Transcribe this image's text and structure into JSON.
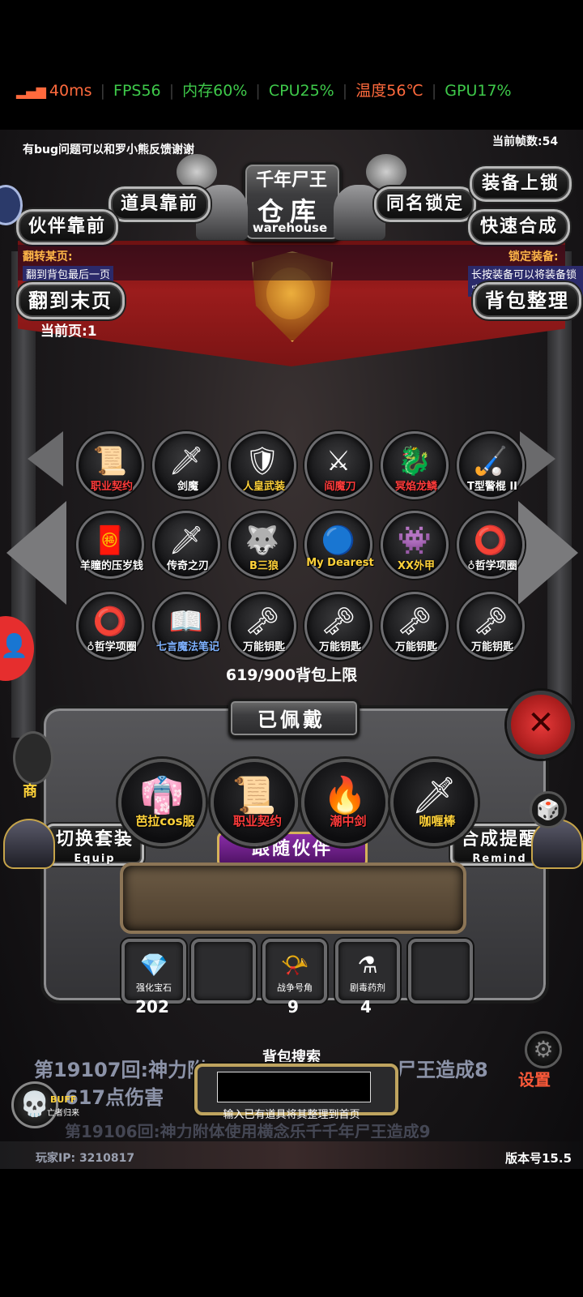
{
  "status": {
    "ping": "40ms",
    "fps": "FPS56",
    "memory": "内存60%",
    "cpu": "CPU25%",
    "temp": "温度56℃",
    "gpu": "GPU17%",
    "colors": {
      "ping": "#ff6a3d",
      "fps": "#3ec94a",
      "memory": "#3ec94a",
      "cpu": "#3ec94a",
      "temp": "#ff6a3d",
      "gpu": "#3ec94a"
    }
  },
  "header": {
    "frame_count": "当前帧数:54",
    "feedback": "有bug问题可以和罗小熊反馈谢谢",
    "boss_name": "千年尸王",
    "title_cn": "仓库",
    "title_en": "warehouse"
  },
  "buttons": {
    "items_first": "道具靠前",
    "companions_first": "伙伴靠前",
    "same_name_lock": "同名锁定",
    "equip_lock": "装备上锁",
    "quick_merge": "快速合成",
    "go_last_page": "翻到末页",
    "bag_sort": "背包整理",
    "switch_set": "切换套装",
    "switch_set_en": "Equip",
    "merge_remind": "合成提醒",
    "merge_remind_en": "Remind",
    "follow_companion": "跟随伙伴",
    "settings": "设置"
  },
  "hints": {
    "flip_page_title": "翻转某页:",
    "flip_page_desc": "翻到背包最后一页",
    "lock_equip_title": "锁定装备:",
    "lock_equip_desc": "长按装备可以将装备锁定",
    "current_page": "当前页:1"
  },
  "inventory": {
    "capacity": "619/900背包上限",
    "items": [
      {
        "label": "职业契约",
        "icon": "📜",
        "color": "#ff3b3b"
      },
      {
        "label": "剑魔",
        "icon": "🗡",
        "color": "#ffffff"
      },
      {
        "label": "人皇武装",
        "icon": "🛡",
        "color": "#ffd23a"
      },
      {
        "label": "阎魔刀",
        "icon": "⚔",
        "color": "#ff3b3b"
      },
      {
        "label": "冥焰龙鳞",
        "icon": "🐉",
        "color": "#ff3b3b"
      },
      {
        "label": "T型警棍 II",
        "icon": "🏑",
        "color": "#ffffff"
      },
      {
        "label": "羊瞳的压岁钱",
        "icon": "🧧",
        "color": "#ffffff"
      },
      {
        "label": "传奇之刃",
        "icon": "🗡",
        "color": "#ffffff"
      },
      {
        "label": "B三狼",
        "icon": "🐺",
        "color": "#ffd23a"
      },
      {
        "label": "My Dearest",
        "icon": "🔵",
        "color": "#ffd23a"
      },
      {
        "label": "XX外甲",
        "icon": "👾",
        "color": "#ffd23a"
      },
      {
        "label": "♁哲学项圈",
        "icon": "⭕",
        "color": "#ffffff"
      },
      {
        "label": "♁哲学项圈",
        "icon": "⭕",
        "color": "#ffffff"
      },
      {
        "label": "七言魔法笔记",
        "icon": "📖",
        "color": "#7fb2ff"
      },
      {
        "label": "万能钥匙",
        "icon": "🗝",
        "color": "#ffffff"
      },
      {
        "label": "万能钥匙",
        "icon": "🗝",
        "color": "#ffffff"
      },
      {
        "label": "万能钥匙",
        "icon": "🗝",
        "color": "#ffffff"
      },
      {
        "label": "万能钥匙",
        "icon": "🗝",
        "color": "#ffffff"
      }
    ]
  },
  "equipped": {
    "title": "已佩戴",
    "items": [
      {
        "label": "芭拉cos服",
        "icon": "👘",
        "color": "#ffd23a"
      },
      {
        "label": "职业契约",
        "icon": "📜",
        "color": "#ff3b3b"
      },
      {
        "label": "潮中剑",
        "icon": "🔥",
        "color": "#ff3b3b"
      },
      {
        "label": "咖喱棒",
        "icon": "🗡",
        "color": "#ffd23a"
      }
    ]
  },
  "consumables": [
    {
      "label": "强化宝石",
      "icon": "💎",
      "count": "202"
    },
    {
      "label": "",
      "icon": "",
      "count": ""
    },
    {
      "label": "战争号角",
      "icon": "📯",
      "count": "9"
    },
    {
      "label": "剧毒药剂",
      "icon": "⚗",
      "count": "4"
    },
    {
      "label": "",
      "icon": "",
      "count": ""
    }
  ],
  "search": {
    "title": "背包搜索",
    "value": "",
    "hint": "输入已有道具将其整理到首页"
  },
  "battle_log": {
    "line1": "第19107回:神力附",
    "line1b": "尸王造成8",
    "line2": "617点伤害",
    "line3": "第19106回:神力附体使用横念乐千千年尸王造成9"
  },
  "footer": {
    "player_ip": "玩家IP:  3210817",
    "version": "版本号15.5",
    "buff_label": "BUFF",
    "buff_desc": "亡者归来"
  },
  "side": {
    "shop": "商"
  }
}
